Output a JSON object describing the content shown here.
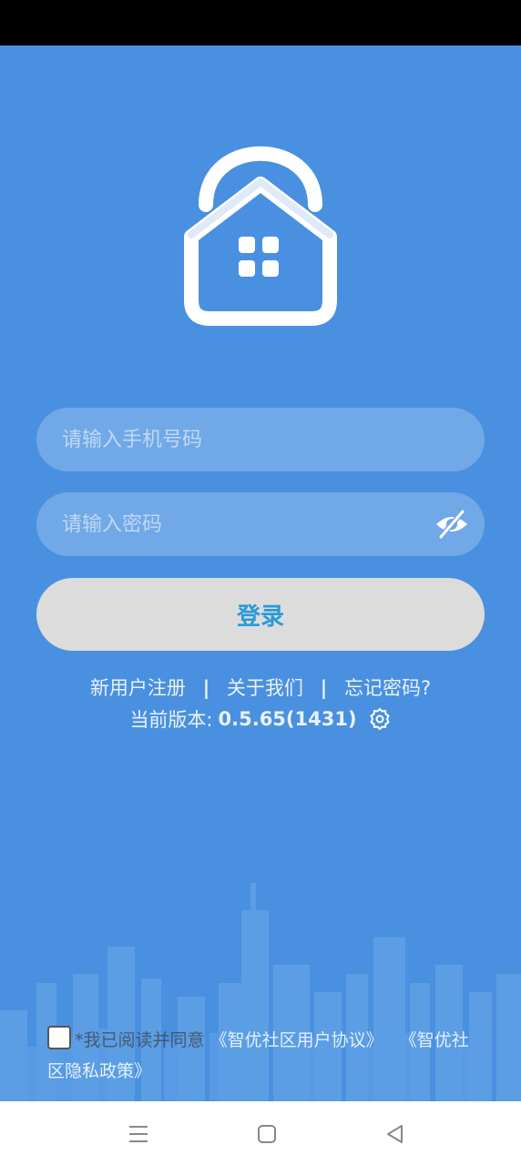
{
  "login": {
    "phone_placeholder": "请输入手机号码",
    "password_placeholder": "请输入密码",
    "login_label": "登录"
  },
  "links": {
    "register": "新用户注册",
    "separator": "|",
    "about": "关于我们",
    "forgot": "忘记密码?"
  },
  "version": {
    "label": "当前版本:",
    "number": "0.5.65(1431)"
  },
  "agreement": {
    "checked": false,
    "star": "*",
    "prefix": "我已阅读并同意",
    "user_agreement": "《智优社区用户协议》",
    "privacy_policy": "《智优社区隐私政策》"
  },
  "icons": {
    "logo": "lock-house-logo",
    "password_toggle": "eye-off-icon",
    "settings": "gear-icon",
    "nav_menu": "menu-icon",
    "nav_home": "square-icon",
    "nav_back": "back-triangle-icon"
  },
  "colors": {
    "background": "#4a90e0",
    "button_bg": "#dcdcdc",
    "button_text": "#2a9ad8"
  }
}
